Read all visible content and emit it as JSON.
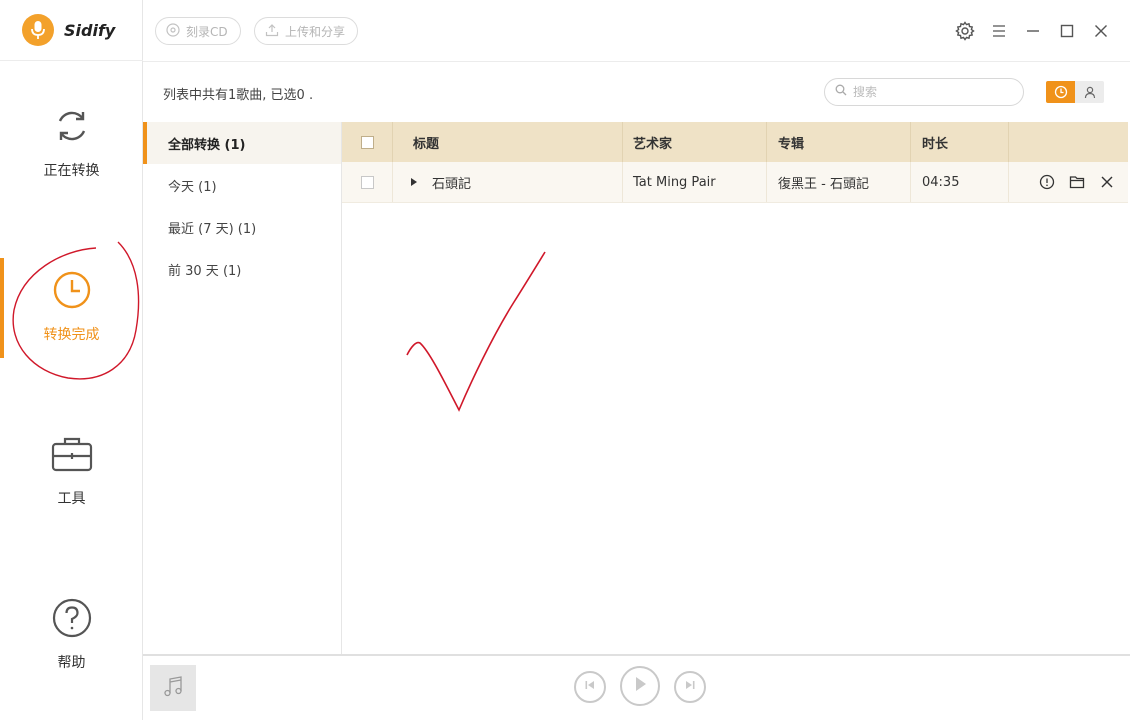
{
  "app": {
    "name": "Sidify"
  },
  "nav": [
    {
      "id": "converting",
      "label": "正在转换",
      "icon": "refresh-icon"
    },
    {
      "id": "converted",
      "label": "转换完成",
      "icon": "clock-icon",
      "active": true
    },
    {
      "id": "tools",
      "label": "工具",
      "icon": "toolbox-icon"
    },
    {
      "id": "help",
      "label": "帮助",
      "icon": "help-icon"
    }
  ],
  "toolbar": {
    "burn_cd": "刻录CD",
    "upload_share": "上传和分享"
  },
  "list": {
    "count_text": "列表中共有1歌曲, 已选0 ."
  },
  "search": {
    "placeholder": "搜索"
  },
  "filters": [
    {
      "label": "全部转换 (1)",
      "active": true
    },
    {
      "label": "今天 (1)"
    },
    {
      "label": "最近 (7 天) (1)"
    },
    {
      "label": "前 30 天 (1)"
    }
  ],
  "table": {
    "headers": {
      "title": "标题",
      "artist": "艺术家",
      "album": "专辑",
      "duration": "时长"
    },
    "rows": [
      {
        "title": "石頭記",
        "artist": "Tat Ming Pair",
        "album": "復黑王 - 石頭記",
        "duration": "04:35"
      }
    ]
  },
  "colors": {
    "accent": "#f0921a",
    "header_bg": "#efe2c6",
    "annotation": "#d0182a"
  }
}
